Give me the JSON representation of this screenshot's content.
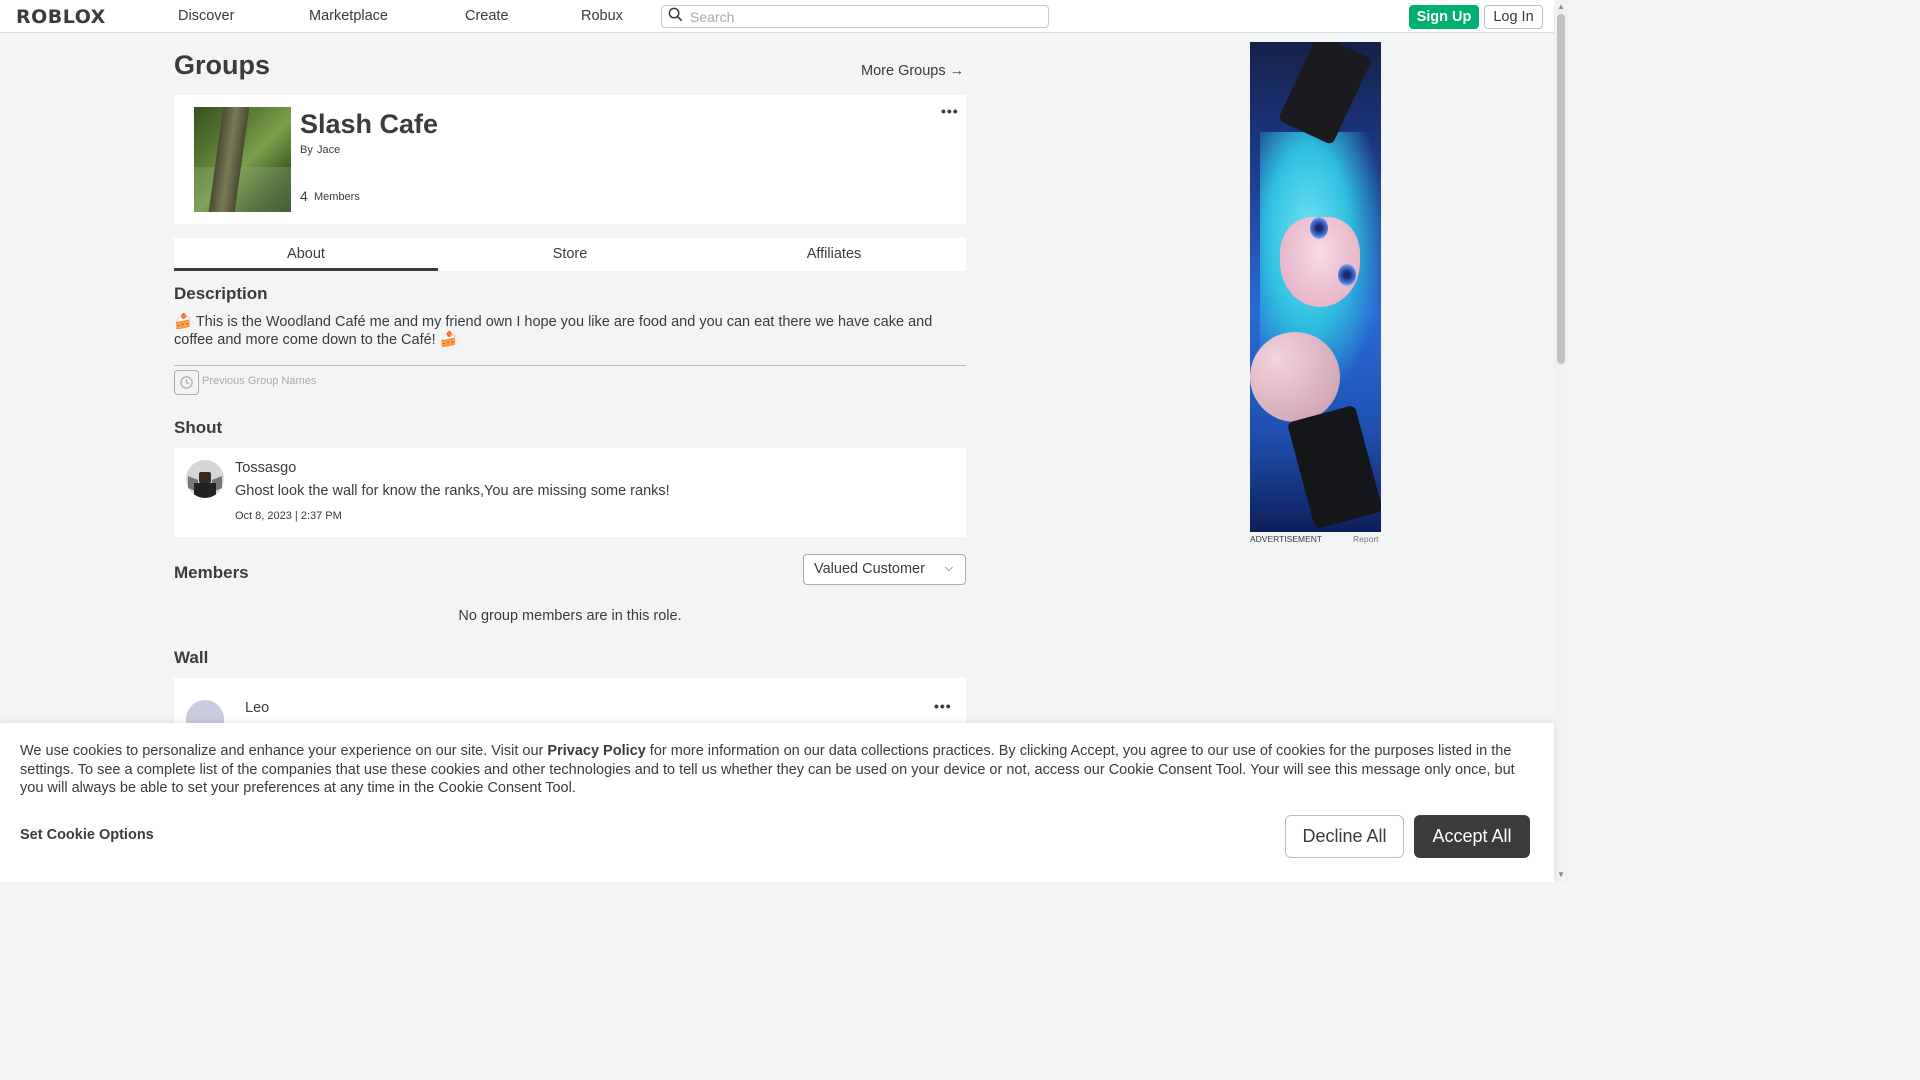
{
  "topbar": {
    "logo": "ROBLOX",
    "nav": [
      "Discover",
      "Marketplace",
      "Create",
      "Robux"
    ],
    "search_placeholder": "Search",
    "signup_label": "Sign Up",
    "login_label": "Log In"
  },
  "page": {
    "title": "Groups",
    "more_groups": "More Groups →"
  },
  "group": {
    "name": "Slash Cafe",
    "owner_prefix": "By",
    "owner": "Jace",
    "member_count": "4",
    "member_label": "Members",
    "menu": "•••"
  },
  "tabs": [
    "About",
    "Store",
    "Affiliates"
  ],
  "about": {
    "description_title": "Description",
    "description": "🍰 This is the Woodland Café me and my friend own I hope you like are food and you can eat there we have cake and coffee and more come down to the Café! 🍰",
    "previous_names": "Previous Group Names"
  },
  "shout": {
    "title": "Shout",
    "user": "Tossasgo",
    "text": "Ghost look the wall for know the ranks,You are missing some ranks!",
    "date": "Oct 8, 2023 | 2:37 PM"
  },
  "members": {
    "title": "Members",
    "role": "Valued Customer",
    "empty": "No group members are in this role."
  },
  "wall": {
    "title": "Wall",
    "user": "Leo",
    "menu": "•••"
  },
  "ad": {
    "label": "ADVERTISEMENT",
    "report": "Report"
  },
  "cookie": {
    "text_before": "We use cookies to personalize and enhance your experience on our site. Visit our ",
    "link": "Privacy Policy",
    "text_after": " for more information on our data collections practices. By clicking Accept, you agree to our use of cookies for the purposes listed in the settings. To see a complete list of the companies that use these cookies and other technologies and to tell us whether they can be used on your device or not, access our Cookie Consent Tool. Your will see this message only once, but you will always be able to set your preferences at any time in the Cookie Consent Tool.",
    "options": "Set Cookie Options",
    "decline": "Decline All",
    "accept": "Accept All"
  }
}
